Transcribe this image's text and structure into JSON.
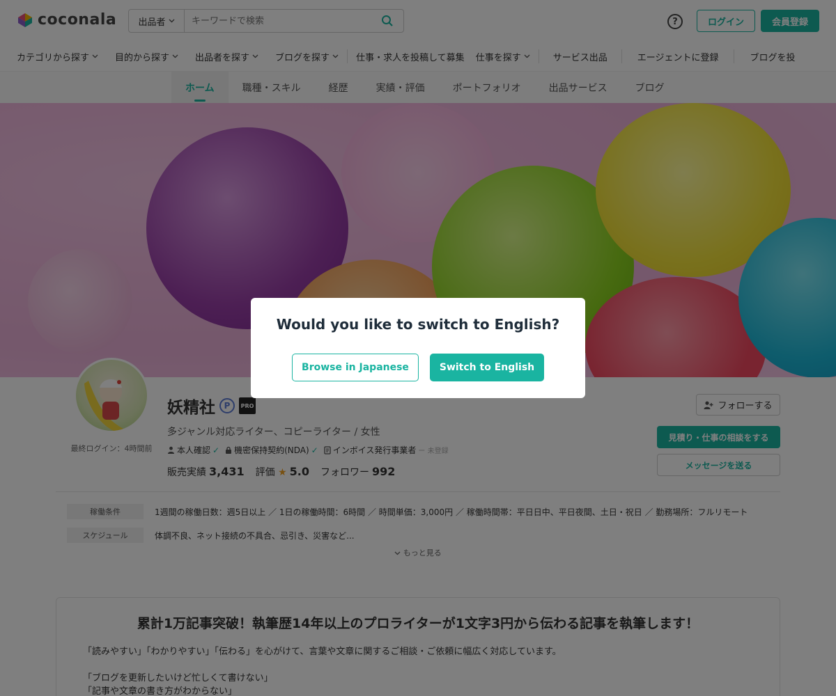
{
  "header": {
    "logo_text": "coconala",
    "search": {
      "scope": "出品者",
      "placeholder": "キーワードで検索"
    },
    "help_label": "?",
    "login_label": "ログイン",
    "signup_label": "会員登録",
    "accent_color": "#1ab4a1"
  },
  "category_nav": {
    "items": [
      "カテゴリから探す",
      "目的から探す",
      "出品者を探す",
      "ブログを探す"
    ],
    "post_jobs": "仕事・求人を投稿して募集",
    "find_work": "仕事を探す",
    "sell_service": "サービス出品",
    "agent_register": "エージェントに登録",
    "blog_post": "ブログを投"
  },
  "profile_tabs": [
    "ホーム",
    "職種・スキル",
    "経歴",
    "実績・評価",
    "ポートフォリオ",
    "出品サービス",
    "ブログ"
  ],
  "profile": {
    "name": "妖精社",
    "badge_p": "P",
    "badge_pro": "PRO",
    "title": "多ジャンル対応ライター、コピーライター / 女性",
    "last_login": "最終ログイン：4時間前",
    "verifications": {
      "identity": "本人確認",
      "nda": "機密保持契約(NDA)",
      "invoice": "インボイス発行事業者",
      "invoice_status": "ー 未登録"
    },
    "stats": {
      "sales_label": "販売実績",
      "sales_value": "3,431",
      "rating_label": "評価",
      "rating_value": "5.0",
      "followers_label": "フォロワー",
      "followers_value": "992"
    },
    "follow_label": "フォローする",
    "consult_label": "見積り・仕事の相談をする",
    "message_label": "メッセージを送る"
  },
  "conditions": {
    "work_label": "稼働条件",
    "work_value": "1週間の稼働日数：週5日以上 ／ 1日の稼働時間：6時間 ／ 時間単価：3,000円 ／ 稼働時間帯：平日日中、平日夜間、土日・祝日 ／ 勤務場所：フルリモート",
    "schedule_label": "スケジュール",
    "schedule_value": "体調不良、ネット接続の不具合、忌引き、災害など...",
    "more_label": "もっと見る"
  },
  "intro": {
    "title": "累計1万記事突破！執筆歴14年以上のプロライターが1文字3円から伝わる記事を執筆します！",
    "line1": "「読みやすい」「わかりやすい」「伝わる」を心がけて、言葉や文章に関するご相談・ご依頼に幅広く対応しています。",
    "line2": "「ブログを更新したいけど忙しくて書けない」",
    "line3": "「記事や文章の書き方がわからない」"
  },
  "modal": {
    "title": "Would you like to switch to English?",
    "browse_japanese": "Browse in Japanese",
    "switch_english": "Switch to English"
  }
}
